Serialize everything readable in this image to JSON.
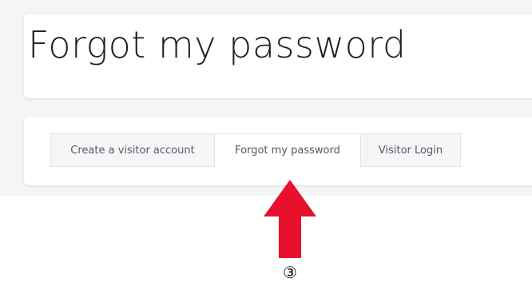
{
  "header": {
    "title": "Forgot my password"
  },
  "tabs": [
    {
      "label": "Create a visitor account",
      "active": false
    },
    {
      "label": "Forgot my password",
      "active": true
    },
    {
      "label": "Visitor Login",
      "active": false
    }
  ],
  "annotation": {
    "step_marker": "③",
    "arrow_color": "#e8112d",
    "arrow_icon": "arrow-up-icon"
  }
}
